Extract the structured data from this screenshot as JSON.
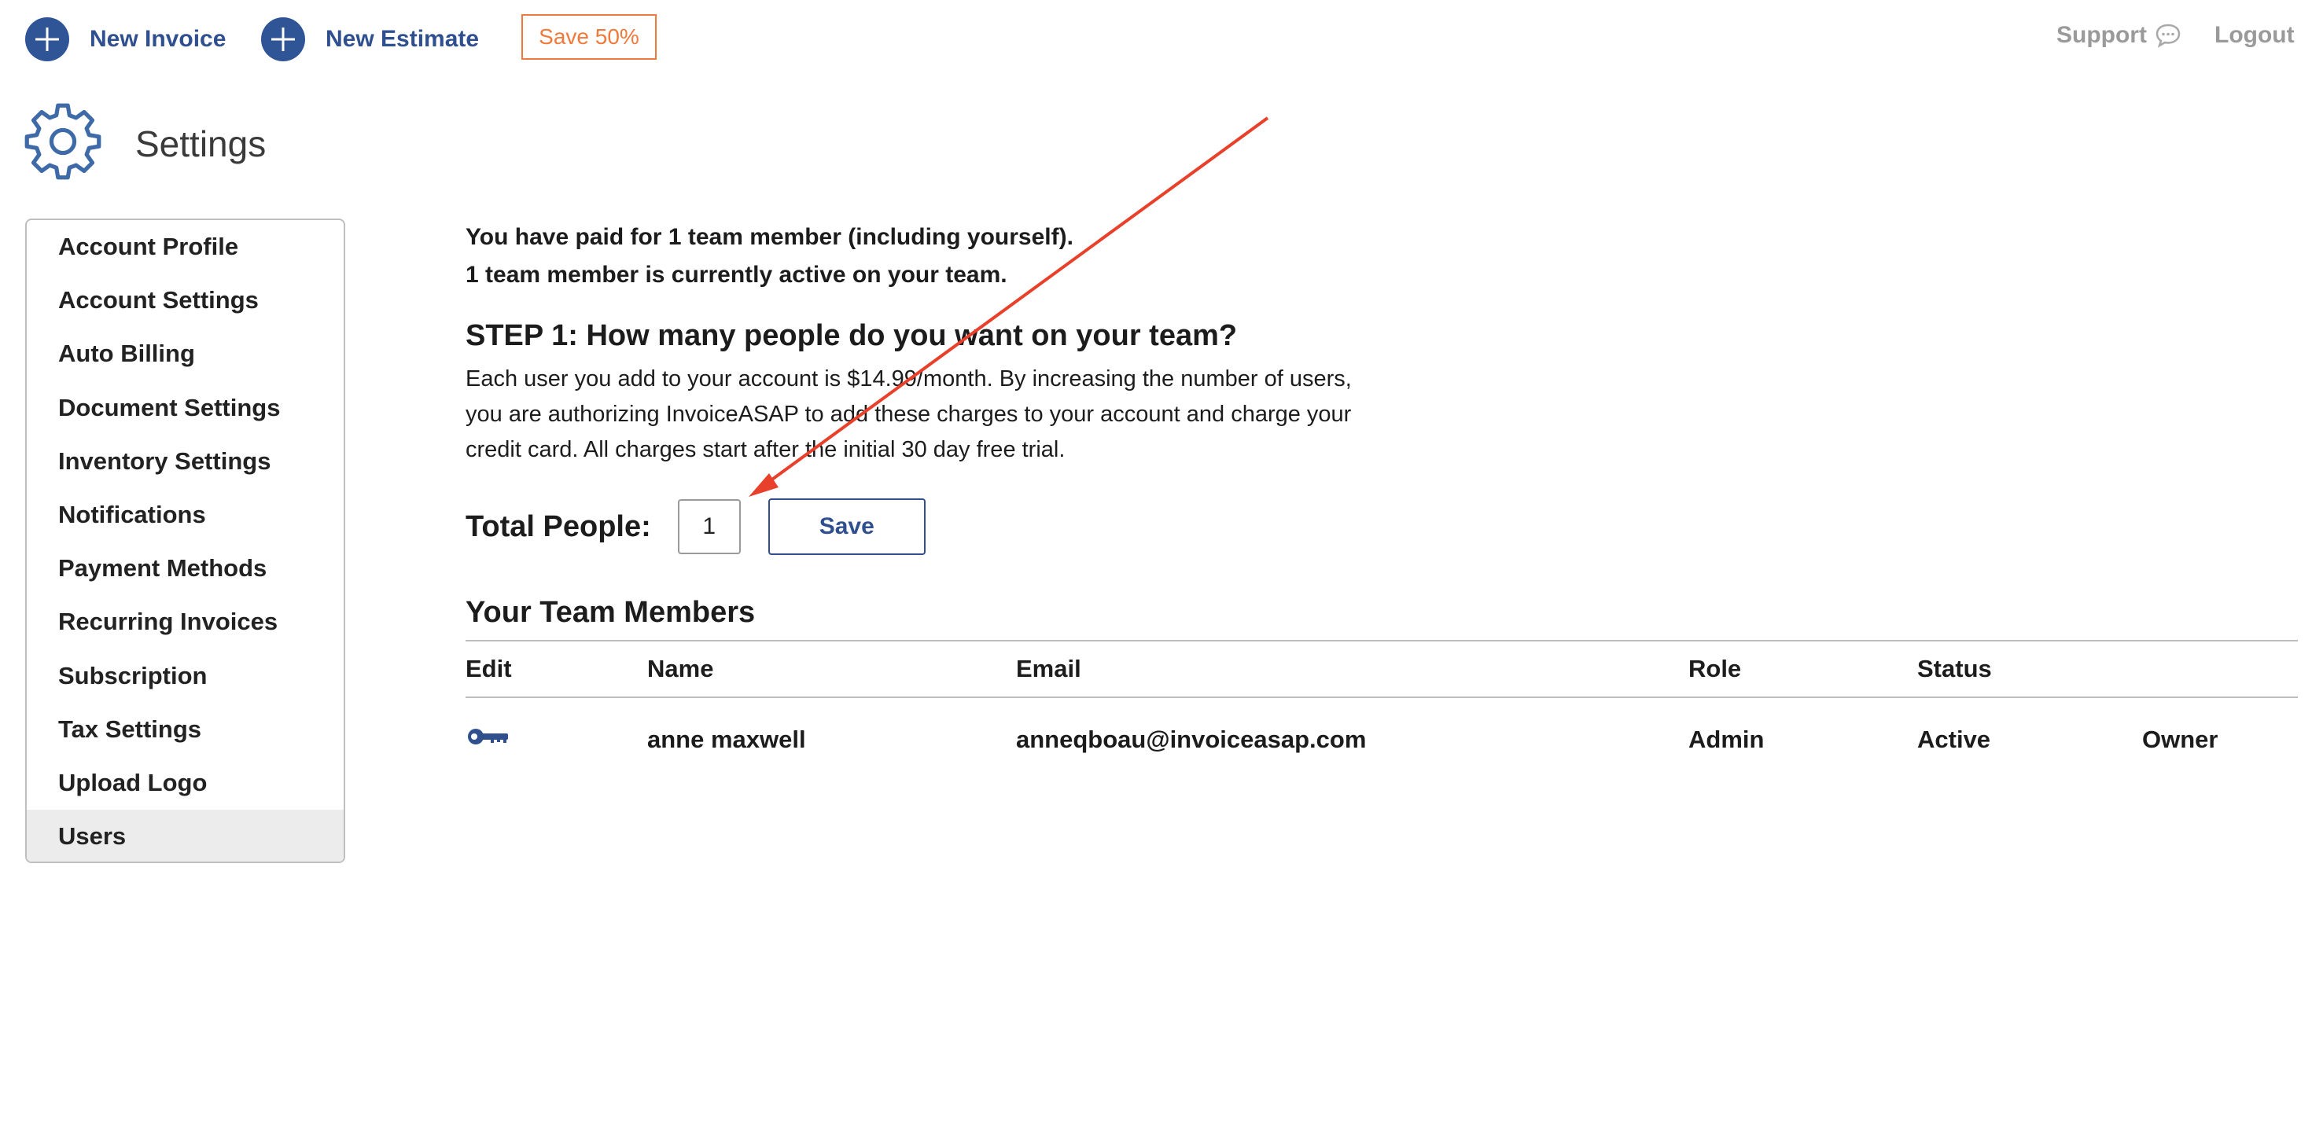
{
  "topbar": {
    "new_invoice": "New Invoice",
    "new_estimate": "New Estimate",
    "promo": "Save 50%",
    "support": "Support",
    "logout": "Logout"
  },
  "header": {
    "title": "Settings",
    "icon": "gear-icon"
  },
  "sidebar": {
    "items": [
      {
        "label": "Account Profile"
      },
      {
        "label": "Account Settings"
      },
      {
        "label": "Auto Billing"
      },
      {
        "label": "Document Settings"
      },
      {
        "label": "Inventory Settings"
      },
      {
        "label": "Notifications"
      },
      {
        "label": "Payment Methods"
      },
      {
        "label": "Recurring Invoices"
      },
      {
        "label": "Subscription"
      },
      {
        "label": "Tax Settings"
      },
      {
        "label": "Upload Logo"
      },
      {
        "label": "Users"
      }
    ],
    "active": "Users"
  },
  "main": {
    "paid_line": "You have paid for 1 team member (including yourself).",
    "active_line": "1 team member is currently active on your team.",
    "step_title": "STEP 1: How many people do you want on your team?",
    "step_desc": "Each user you add to your account is $14.99/month. By increasing the number of users, you are authorizing InvoiceASAP to add these charges to your account and charge your credit card. All charges start after the initial 30 day free trial.",
    "total_people_label": "Total People:",
    "total_people_value": "1",
    "save_label": "Save",
    "team_title": "Your Team Members",
    "table": {
      "headers": [
        "Edit",
        "Name",
        "Email",
        "Role",
        "Status"
      ],
      "rows": [
        {
          "edit_icon": "key-icon",
          "name": "anne maxwell",
          "email": "anneqboau@invoiceasap.com",
          "role": "Admin",
          "status": "Active",
          "extra": "Owner"
        }
      ]
    }
  },
  "colors": {
    "brand_blue": "#2f4f8f",
    "promo_orange": "#ef7a3b",
    "annotation_red": "#e8402a"
  }
}
